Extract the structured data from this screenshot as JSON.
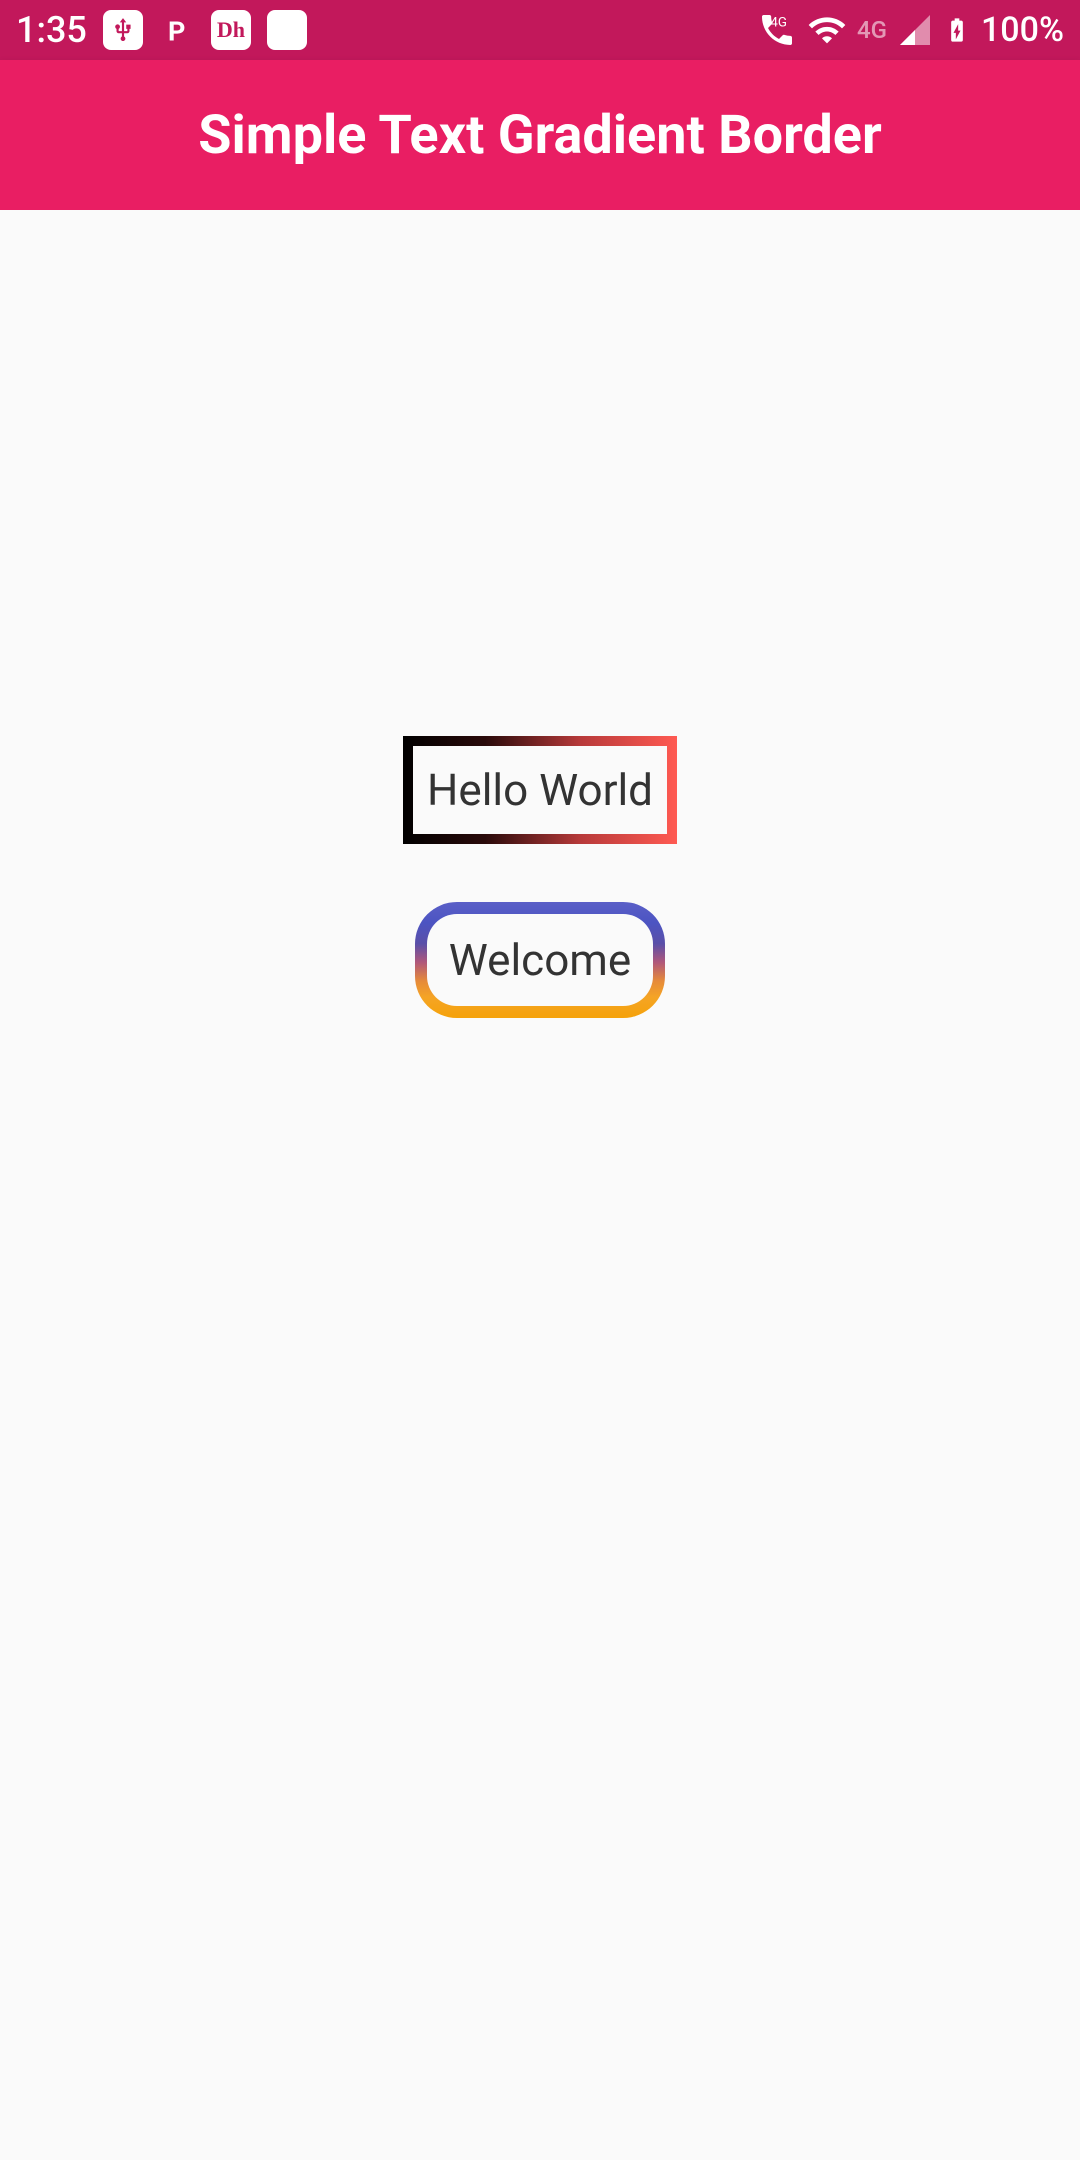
{
  "status_bar": {
    "time": "1:35",
    "battery": "100%",
    "network_4g": "4G",
    "network_4g_dim": "4G"
  },
  "app_bar": {
    "title": "Simple Text Gradient Border"
  },
  "content": {
    "box1_text": "Hello World",
    "box2_text": "Welcome"
  }
}
